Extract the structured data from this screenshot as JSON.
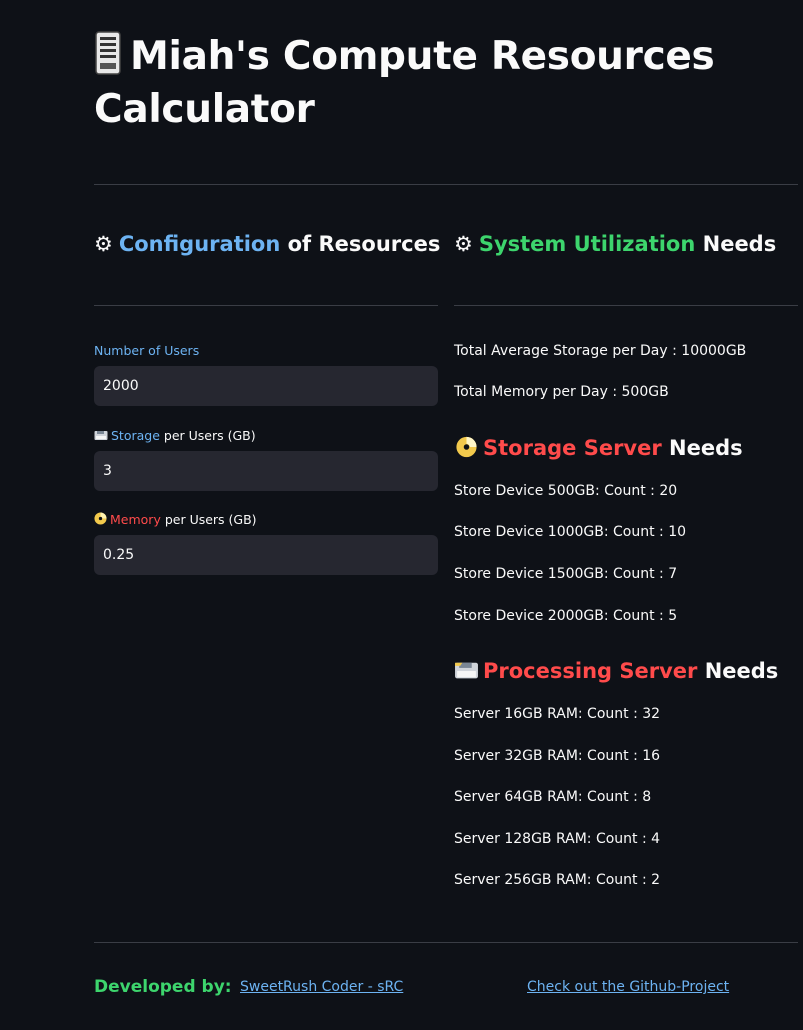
{
  "header": {
    "title": "Miah's Compute Resources Calculator",
    "title_icon": "desktop-tower-icon"
  },
  "config_section": {
    "gear": "⚙",
    "heading_accent": "Configuration",
    "heading_rest": "of Resources"
  },
  "fields": {
    "users": {
      "label": "Number of Users",
      "value": "2000"
    },
    "storage": {
      "icon": "floppy-disk-icon",
      "label_accent": "Storage",
      "label_rest": "per Users (GB)",
      "value": "3"
    },
    "memory": {
      "icon": "optical-disc-icon",
      "label_accent": "Memory",
      "label_rest": "per Users (GB)",
      "value": "0.25"
    }
  },
  "utilization_section": {
    "gear": "⚙",
    "heading_accent": "System Utilization",
    "heading_rest": "Needs",
    "total_storage": "Total Average Storage per Day : 10000GB",
    "total_memory": "Total Memory per Day : 500GB"
  },
  "storage_server": {
    "icon": "optical-disc-icon",
    "heading_accent": "Storage Server",
    "heading_rest": "Needs",
    "items": [
      "Store Device 500GB: Count : 20",
      "Store Device 1000GB: Count : 10",
      "Store Device 1500GB: Count : 7",
      "Store Device 2000GB: Count : 5"
    ]
  },
  "processing_server": {
    "icon": "floppy-disk-icon",
    "heading_accent": "Processing Server",
    "heading_rest": "Needs",
    "items": [
      "Server 16GB RAM: Count : 32",
      "Server 32GB RAM: Count : 16",
      "Server 64GB RAM: Count : 8",
      "Server 128GB RAM: Count : 4",
      "Server 256GB RAM: Count : 2"
    ]
  },
  "footer": {
    "developed_by": "Developed by:",
    "author_link": "SweetRush Coder - sRC",
    "github_link": "Check out the Github-Project"
  },
  "colors": {
    "background": "#0e1117",
    "input_bg": "#262730",
    "blue_accent": "#6db3f2",
    "green_accent": "#3dd56d",
    "red_accent": "#ff4b4b"
  }
}
